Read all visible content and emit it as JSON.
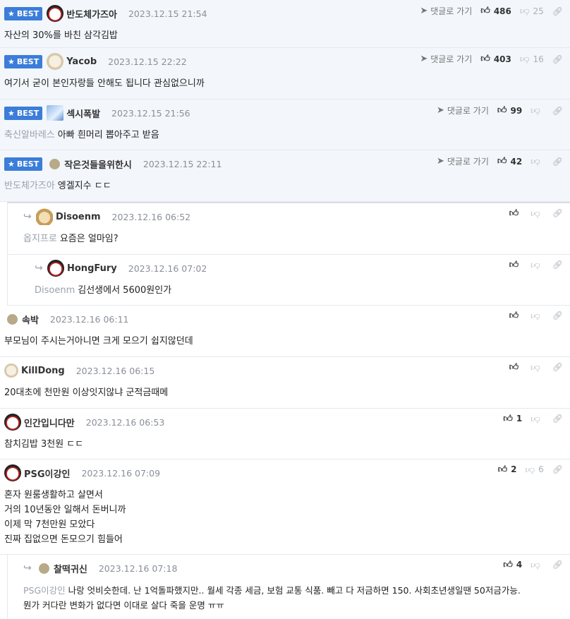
{
  "labels": {
    "best": "BEST",
    "reply_link": "댓글로 가기"
  },
  "comments": [
    {
      "author": "반도체가즈아",
      "date": "2023.12.15 21:54",
      "body": "자산의 30%를 바친 삼각김밥",
      "tag": "",
      "up": "486",
      "down": "25"
    },
    {
      "author": "Yacob",
      "date": "2023.12.15 22:22",
      "body": "여기서 굳이 본인자랑들 안해도 됩니다 관심없으니까",
      "tag": "",
      "up": "403",
      "down": "16"
    },
    {
      "author": "섹시폭발",
      "date": "2023.12.15 21:56",
      "body": "아빠 흰머리 뽑아주고 받음",
      "tag": "축신알바레스",
      "up": "99",
      "down": ""
    },
    {
      "author": "작은것들을위한시",
      "date": "2023.12.15 22:11",
      "body": "엥겔지수 ㄷㄷ",
      "tag": "반도체가즈아",
      "up": "42",
      "down": ""
    },
    {
      "author": "Disoenm",
      "date": "2023.12.16 06:52",
      "body": "요즘은 얼마임?",
      "tag": "옵지프로",
      "up": "",
      "down": ""
    },
    {
      "author": "HongFury",
      "date": "2023.12.16 07:02",
      "body": "김선생에서 5600원인가",
      "tag": "Disoenm",
      "up": "",
      "down": ""
    },
    {
      "author": "속박",
      "date": "2023.12.16 06:11",
      "body": "부모님이 주시는거아니면 크게 모으기 쉽지않던데",
      "tag": "",
      "up": "",
      "down": ""
    },
    {
      "author": "KillDong",
      "date": "2023.12.16 06:15",
      "body": "20대초에 천만원 이상잇지않냐 군적금때메",
      "tag": "",
      "up": "",
      "down": ""
    },
    {
      "author": "인간입니다만",
      "date": "2023.12.16 06:53",
      "body": "참치김밥 3천원 ㄷㄷ",
      "tag": "",
      "up": "1",
      "down": ""
    },
    {
      "author": "PSG이강인",
      "date": "2023.12.16 07:09",
      "body_lines": [
        "혼자 원룸생활하고 살면서",
        "거의 10년동안 일해서 돈버니까",
        "이제 막 7천만원 모았다",
        "진짜 집없으면 돈모으기 힘들어"
      ],
      "tag": "",
      "up": "2",
      "down": "6"
    },
    {
      "author": "찰떡귀신",
      "date": "2023.12.16 07:18",
      "body_lines": [
        "나랑 엇비슷한데. 난 1억돌파했지만.. 월세 각종 세금, 보험 교통 식품. 빼고 다 저금하면 150. 사회초년생일땐 50저금가능.",
        "뭔가 커다란 변화가 없다면 이대로 살다 죽을 운명 ㅠㅠ"
      ],
      "tag": "PSG이강인",
      "up": "4",
      "down": ""
    }
  ],
  "icons": {
    "link": "paper-plane-icon",
    "up": "thumb-up-icon",
    "down": "thumb-down-icon",
    "share": "link-icon",
    "star": "star-icon",
    "reply": "reply-arrow-icon"
  },
  "colors": {
    "best_badge": "#3b7dd8",
    "best_bg": "#f3f6fb"
  }
}
